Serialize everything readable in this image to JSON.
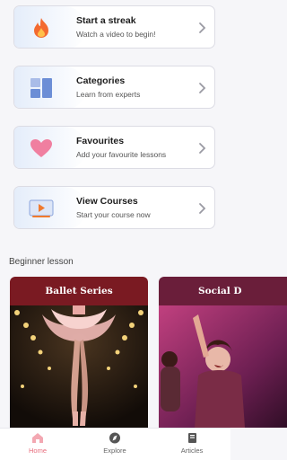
{
  "cards": [
    {
      "title": "Start a streak",
      "subtitle": "Watch a video to begin!",
      "icon": "flame-icon"
    },
    {
      "title": "Categories",
      "subtitle": "Learn from experts",
      "icon": "grid-icon"
    },
    {
      "title": "Favourites",
      "subtitle": "Add your favourite lessons",
      "icon": "heart-icon"
    },
    {
      "title": "View Courses",
      "subtitle": "Start your course now",
      "icon": "video-icon"
    }
  ],
  "section_title": "Beginner lesson",
  "lessons": [
    {
      "title": "Ballet Series"
    },
    {
      "title": "Social D"
    }
  ],
  "nav": [
    {
      "label": "Home",
      "icon": "home-icon",
      "active": true
    },
    {
      "label": "Explore",
      "icon": "compass-icon",
      "active": false
    },
    {
      "label": "Articles",
      "icon": "book-icon",
      "active": false
    }
  ],
  "colors": {
    "accent": "#e86e7e",
    "background": "#f6f6f9",
    "lesson_header_1": "#7a1a22",
    "lesson_header_2": "#6a1e3a"
  }
}
